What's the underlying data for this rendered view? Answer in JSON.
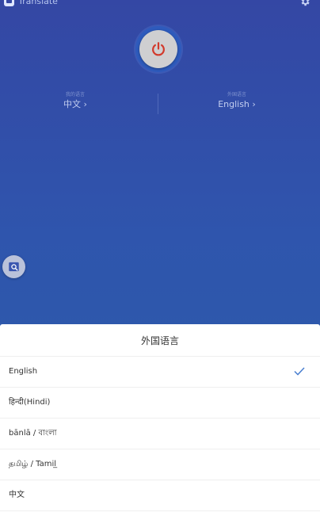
{
  "app": {
    "title": "Translate",
    "app_icon": "app-icon",
    "settings_icon": "gear-icon"
  },
  "power": {
    "icon": "power-icon",
    "icon_color": "#d23a2c"
  },
  "languages": {
    "my_language": {
      "label": "我的语言",
      "value": "中文 ›"
    },
    "foreign_language": {
      "label": "外国语言",
      "value": "English ›"
    }
  },
  "fab": {
    "icon": "image-search-icon"
  },
  "sheet": {
    "title": "外国语言",
    "options": [
      {
        "label": "English",
        "selected": true
      },
      {
        "label": "हिन्दी(Hindi)",
        "selected": false
      },
      {
        "label": "bānlā / বাংলা",
        "selected": false
      },
      {
        "label": "தமிழ் / Tamil̲",
        "selected": false
      },
      {
        "label": "中文",
        "selected": false
      }
    ],
    "check_color": "#4a7fd0"
  },
  "colors": {
    "background_top": "#3447a4",
    "background_bottom": "#2a5da9"
  }
}
